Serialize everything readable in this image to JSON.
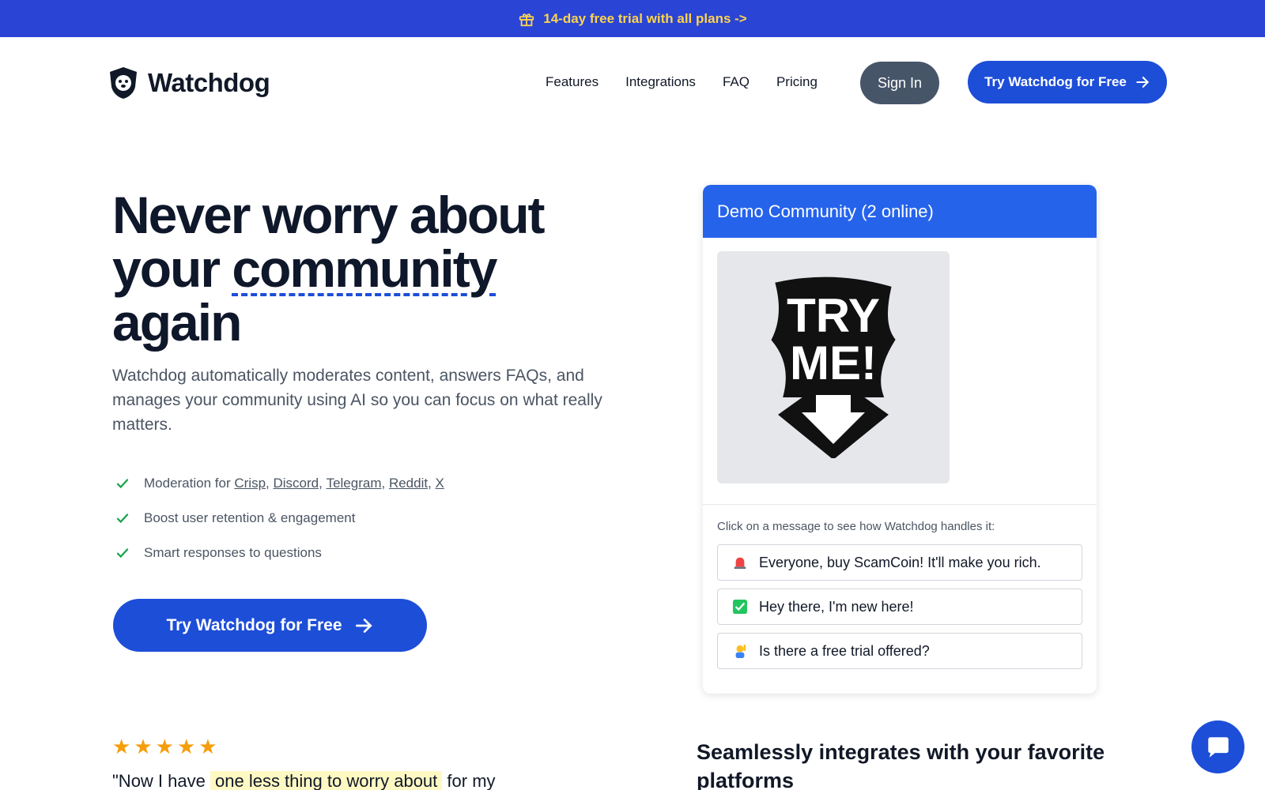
{
  "banner": {
    "text": "14-day free trial with all plans ->",
    "icon": "gift-icon"
  },
  "nav": {
    "brand": "Watchdog",
    "links": [
      "Features",
      "Integrations",
      "FAQ",
      "Pricing"
    ],
    "signin_label": "Sign In",
    "cta_label": "Try Watchdog for Free"
  },
  "hero": {
    "title_line1": "Never worry about",
    "title_line2_pre": "your",
    "title_line2_highlight": "community",
    "title_line3": "again",
    "subtitle": "Watchdog automatically moderates content, answers FAQs, and manages your community using AI so you can focus on what really matters.",
    "features": {
      "moderation_prefix": "Moderation for",
      "platforms": [
        "Crisp",
        "Discord",
        "Telegram",
        "Reddit",
        "X"
      ],
      "item2": "Boost user retention & engagement",
      "item3": "Smart responses to questions"
    },
    "cta_label": "Try Watchdog for Free"
  },
  "review": {
    "stars": 5,
    "quote_pre": "\"Now I have",
    "quote_highlight": "one less thing to worry about",
    "quote_post": "for my"
  },
  "demo": {
    "header": "Demo Community (2 online)",
    "image_text_1": "TRY",
    "image_text_2": "ME!",
    "hint": "Click on a message to see how Watchdog handles it:",
    "messages": [
      {
        "icon": "siren-icon",
        "text": "Everyone, buy ScamCoin! It'll make you rich."
      },
      {
        "icon": "check-mark-icon",
        "text": "Hey there, I'm new here!"
      },
      {
        "icon": "raising-hand-icon",
        "text": "Is there a free trial offered?"
      }
    ]
  },
  "integrations": {
    "title": "Seamlessly integrates with your favorite platforms"
  },
  "colors": {
    "primary": "#1d4ed8",
    "banner": "#2a44d6",
    "banner_text": "#fcd34d",
    "check": "#16a34a",
    "star": "#f59e0b"
  }
}
